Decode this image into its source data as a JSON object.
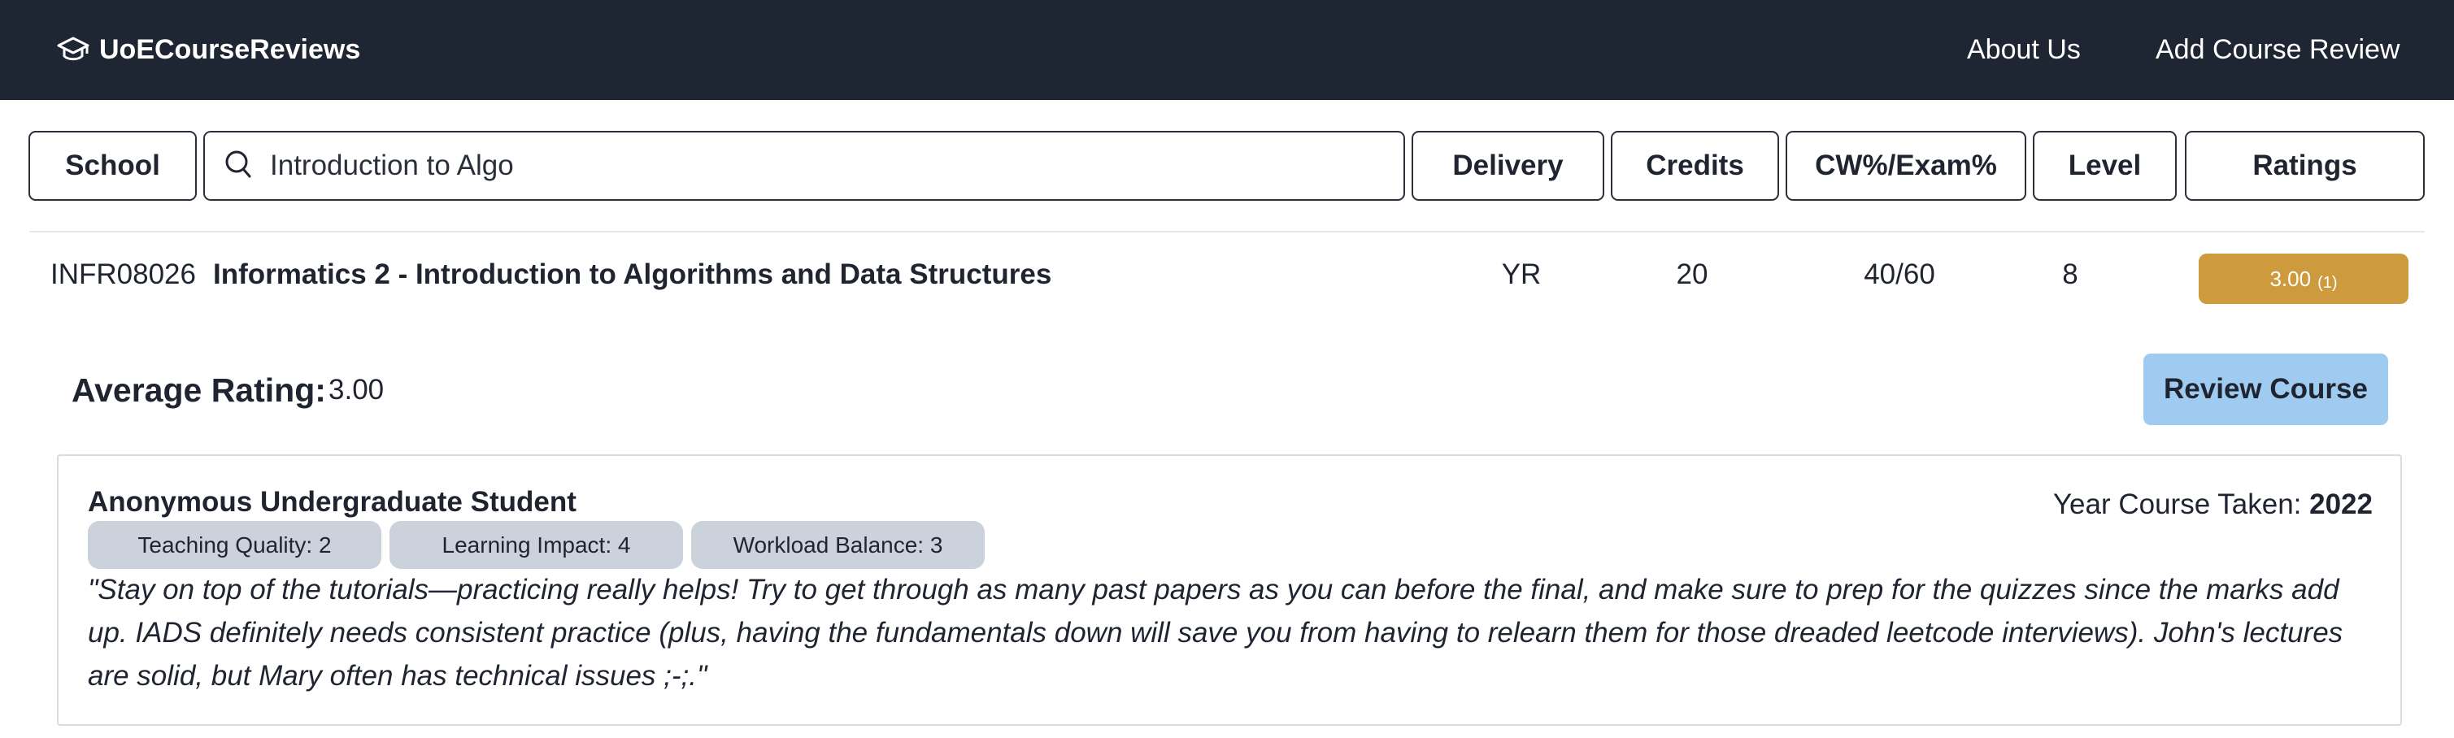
{
  "navbar": {
    "brand": "UoECourseReviews",
    "brand_icon": "graduation-cap-icon",
    "links": [
      "About Us",
      "Add Course Review"
    ]
  },
  "filters": {
    "school": "School",
    "search_value": "Introduction to Algo",
    "search_icon": "search-icon",
    "delivery": "Delivery",
    "credits": "Credits",
    "cw_exam": "CW%/Exam%",
    "level": "Level",
    "ratings": "Ratings"
  },
  "course": {
    "code": "INFR08026",
    "name": "Informatics 2 - Introduction to Algorithms and Data Structures",
    "delivery": "YR",
    "credits": "20",
    "cw_exam": "40/60",
    "level": "8",
    "rating": "3.00",
    "rating_count": "(1)",
    "rating_color": "#cd9b3d"
  },
  "summary": {
    "avg_label": "Average Rating:",
    "avg_value": "3.00",
    "review_button": "Review Course",
    "review_button_color": "#9ecbef"
  },
  "review": {
    "author": "Anonymous Undergraduate Student",
    "year_label": "Year Course Taken:",
    "year_value": "2022",
    "tags": [
      "Teaching Quality: 2",
      "Learning Impact: 4",
      "Workload Balance: 3"
    ],
    "text": "\"Stay on top of the tutorials—practicing really helps! Try to get through as many past papers as you can before the final, and make sure to prep for the quizzes since the marks add up. IADS definitely needs consistent practice (plus, having the fundamentals down will save you from having to relearn them for those dreaded leetcode interviews). John's lectures are solid, but Mary often has technical issues ;-;.\""
  },
  "colors": {
    "navbar": "#1e2533",
    "tag_bg": "#cbd2dc"
  }
}
